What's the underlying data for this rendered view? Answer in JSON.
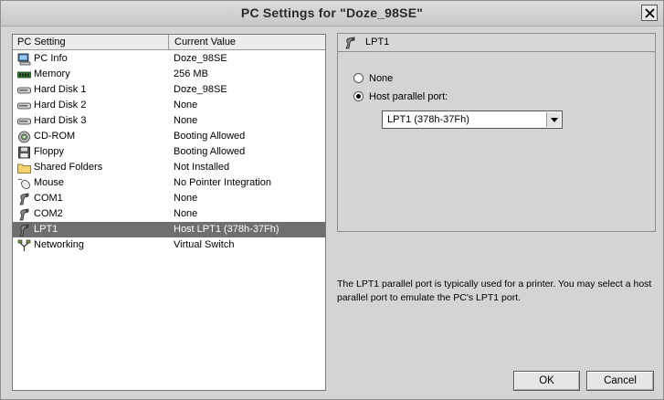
{
  "window": {
    "title": "PC Settings for \"Doze_98SE\""
  },
  "settings_list": {
    "columns": [
      "PC Setting",
      "Current Value"
    ],
    "rows": [
      {
        "label": "PC Info",
        "value": "Doze_98SE",
        "icon": "pc-info-icon"
      },
      {
        "label": "Memory",
        "value": "256 MB",
        "icon": "memory-icon"
      },
      {
        "label": "Hard Disk 1",
        "value": "Doze_98SE",
        "icon": "hard-disk-icon"
      },
      {
        "label": "Hard Disk 2",
        "value": "None",
        "icon": "hard-disk-icon"
      },
      {
        "label": "Hard Disk 3",
        "value": "None",
        "icon": "hard-disk-icon"
      },
      {
        "label": "CD-ROM",
        "value": "Booting Allowed",
        "icon": "cd-rom-icon"
      },
      {
        "label": "Floppy",
        "value": "Booting Allowed",
        "icon": "floppy-icon"
      },
      {
        "label": "Shared Folders",
        "value": "Not Installed",
        "icon": "folder-icon"
      },
      {
        "label": "Mouse",
        "value": "No Pointer Integration",
        "icon": "mouse-icon"
      },
      {
        "label": "COM1",
        "value": "None",
        "icon": "port-icon"
      },
      {
        "label": "COM2",
        "value": "None",
        "icon": "port-icon"
      },
      {
        "label": "LPT1",
        "value": "Host LPT1 (378h-37Fh)",
        "icon": "port-icon",
        "selected": true
      },
      {
        "label": "Networking",
        "value": "Virtual Switch",
        "icon": "network-icon"
      }
    ]
  },
  "detail": {
    "title": "LPT1",
    "options": [
      {
        "label": "None",
        "checked": false
      },
      {
        "label": "Host parallel port:",
        "checked": true
      }
    ],
    "port_select": {
      "value": "LPT1 (378h-37Fh)"
    }
  },
  "description": "The LPT1 parallel port is typically used for a printer. You may select a host parallel port to emulate the PC's LPT1 port.",
  "buttons": {
    "ok": "OK",
    "cancel": "Cancel"
  }
}
